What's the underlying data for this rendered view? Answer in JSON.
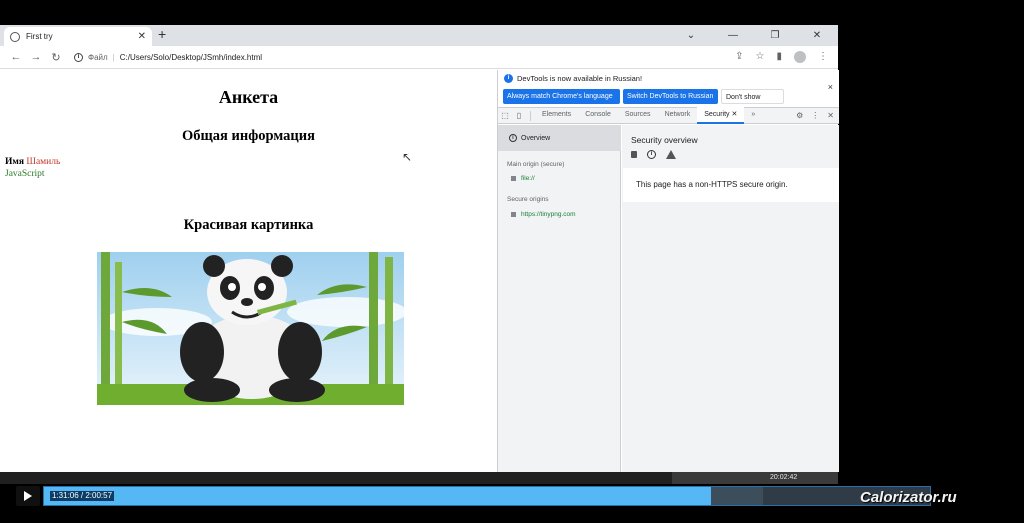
{
  "browser": {
    "tab_title": "First try",
    "new_tab": "+",
    "window_controls": [
      "⌄",
      "—",
      "❐",
      "✕"
    ],
    "nav": [
      "←",
      "→",
      "↻"
    ],
    "omnibox_scheme": "Файл",
    "omnibox_sep": "|",
    "url": "C:/Users/Solo/Desktop/JSmh/index.html",
    "toolbar_icons": [
      "⇪",
      "☆",
      "▮"
    ]
  },
  "page": {
    "h1": "Анкета",
    "h2_general": "Общая информация",
    "field_label": "Имя",
    "field_value": "Шамиль",
    "js_text": "JavaScript",
    "h2_picture": "Красивая картинка",
    "cursor": "↖"
  },
  "devtools": {
    "info_icon": "i",
    "info_text": "DevTools is now available in Russian!",
    "btn_match": "Always match Chrome's language",
    "btn_switch": "Switch DevTools to Russian",
    "btn_dont": "Don't show again",
    "close": "×",
    "tabs": [
      "Elements",
      "Console",
      "Sources",
      "Network",
      "Security"
    ],
    "active_tab_close": "✕",
    "more_tabs": "»",
    "right_icons": [
      "⚙",
      "⋮",
      "✕"
    ],
    "sidebar": {
      "overview": "Overview",
      "main_origin_heading": "Main origin (secure)",
      "main_origin": "file://",
      "secure_origins_heading": "Secure origins",
      "secure_origin": "https://tinypng.com"
    },
    "main": {
      "title": "Security overview",
      "message": "This page has a non-HTTPS secure origin."
    }
  },
  "taskbar": {
    "time": "20:02:42"
  },
  "player": {
    "time": "1:31:06 / 2:00:57",
    "played_fraction": 0.753,
    "buffered_end_fraction": 0.812,
    "accent": "#55b8f5"
  },
  "watermark": "Calorizator.ru"
}
